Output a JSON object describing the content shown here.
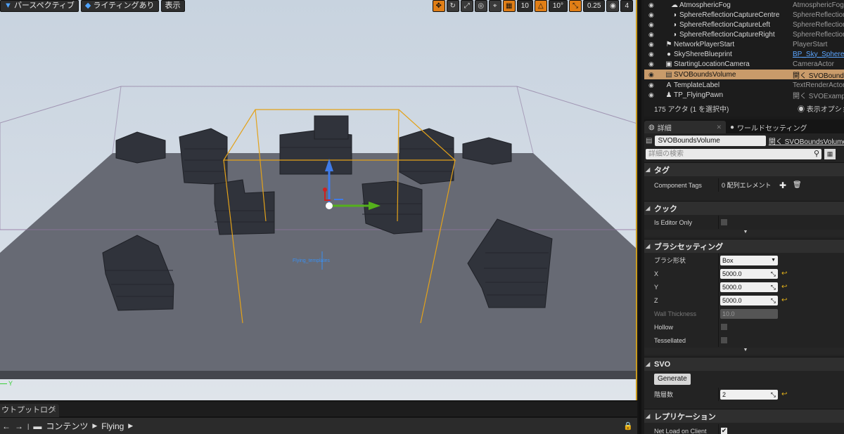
{
  "viewport": {
    "perspective_label": "パースペクティブ",
    "lighting_label": "ライティングあり",
    "show_label": "表示",
    "grid_snap": "10",
    "rot_snap": "10°",
    "scale_snap": "0.25",
    "camera_speed": "4",
    "axis_label": "Y",
    "actor_label": "Flying_templates"
  },
  "output_log": {
    "tab_label": "ウトプットログ"
  },
  "content_browser": {
    "content_label": "コンテンツ",
    "folder_label": "Flying"
  },
  "outliner": {
    "rows": [
      {
        "name": "AtmosphericFog",
        "type": "AtmosphericFog"
      },
      {
        "name": "SphereReflectionCaptureCentre",
        "type": "SphereReflectionC"
      },
      {
        "name": "SphereReflectionCaptureLeft",
        "type": "SphereReflectionC"
      },
      {
        "name": "SphereReflectionCaptureRight",
        "type": "SphereReflectionC"
      },
      {
        "name": "NetworkPlayerStart",
        "type": "PlayerStart"
      },
      {
        "name": "SkyShereBlueprint",
        "type": "BP_Sky_Sphere"
      },
      {
        "name": "StartingLocationCamera",
        "type": "CameraActor"
      },
      {
        "name": "SVOBoundsVolume",
        "type": "開く SVOBounds"
      },
      {
        "name": "TemplateLabel",
        "type": "TextRenderActor"
      },
      {
        "name": "TP_FlyingPawn",
        "type": "開く SVOExampl"
      }
    ],
    "footer_count": "175 アクタ (1 を選択中)",
    "footer_view_options": "表示オプショ"
  },
  "details": {
    "tab_details": "詳細",
    "tab_world": "ワールドセッティング",
    "name_value": "SVOBoundsVolume",
    "open_link": "開く SVOBoundsVolume",
    "search_placeholder": "詳細の検索",
    "cat_tags": "タグ",
    "component_tags_label": "Component Tags",
    "component_tags_value": "0 配列エレメント",
    "cat_cook": "クック",
    "is_editor_only_label": "Is Editor Only",
    "cat_brush": "ブラシセッティング",
    "brush_shape_label": "ブラシ形状",
    "brush_shape_value": "Box",
    "x_label": "X",
    "x_value": "5000.0",
    "y_label": "Y",
    "y_value": "5000.0",
    "z_label": "Z",
    "z_value": "5000.0",
    "wall_label": "Wall Thickness",
    "wall_value": "10.0",
    "hollow_label": "Hollow",
    "tessellated_label": "Tessellated",
    "cat_svo": "SVO",
    "generate_label": "Generate",
    "layers_label": "階層数",
    "layers_value": "2",
    "cat_replication": "レプリケーション",
    "net_load_label": "Net Load on Client"
  },
  "colors": {
    "selection": "#c99b6a",
    "bounds": "#e3a21a",
    "accent_link": "#5aa5ff"
  }
}
